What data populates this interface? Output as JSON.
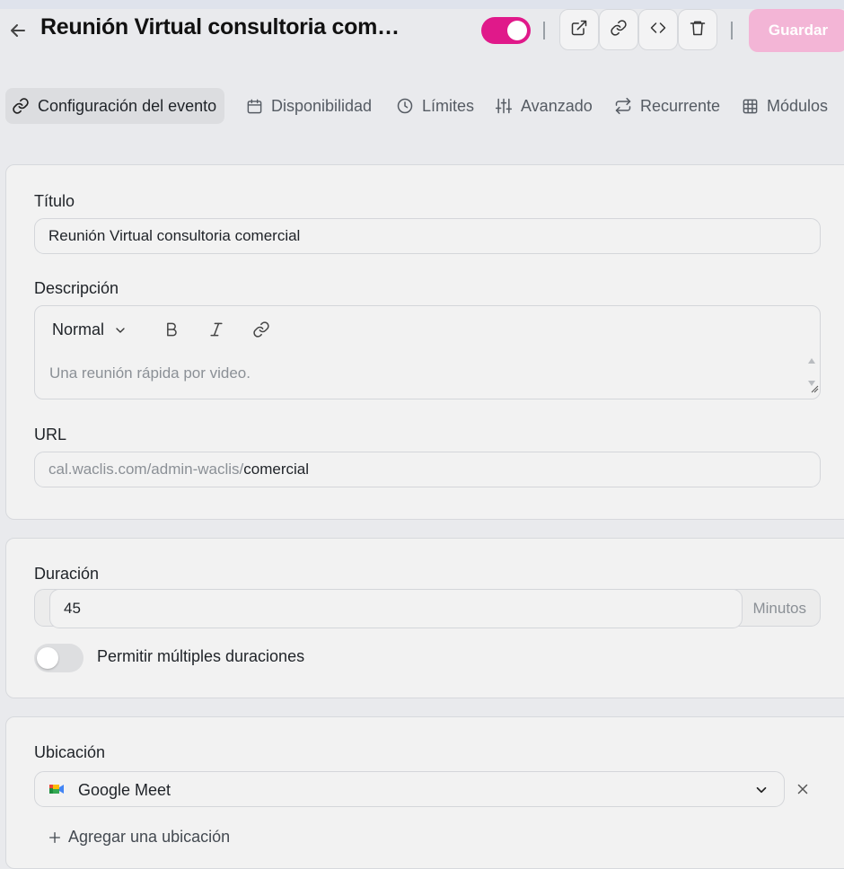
{
  "header": {
    "title": "Reunión Virtual consultoria com…",
    "enabled": true,
    "save_label": "Guardar",
    "actions": [
      "external-link-icon",
      "link-icon",
      "code-icon",
      "trash-icon"
    ]
  },
  "tabs": [
    {
      "label": "Configuración del evento",
      "icon": "link-icon",
      "active": true
    },
    {
      "label": "Disponibilidad",
      "icon": "calendar-icon",
      "active": false
    },
    {
      "label": "Límites",
      "icon": "clock-icon",
      "active": false
    },
    {
      "label": "Avanzado",
      "icon": "sliders-icon",
      "active": false
    },
    {
      "label": "Recurrente",
      "icon": "repeat-icon",
      "active": false
    },
    {
      "label": "Módulos",
      "icon": "grid-icon",
      "active": false
    }
  ],
  "form": {
    "title_label": "Título",
    "title_value": "Reunión Virtual consultoria comercial",
    "description_label": "Descripción",
    "editor_style": "Normal",
    "description_placeholder": "Una reunión rápida por video.",
    "url_label": "URL",
    "url_prefix": "cal.waclis.com/admin-waclis/",
    "url_slug": "comercial"
  },
  "duration": {
    "label": "Duración",
    "value": "45",
    "unit": "Minutos",
    "multiple_label": "Permitir múltiples duraciones",
    "multiple_enabled": false
  },
  "location": {
    "label": "Ubicación",
    "selected": "Google Meet",
    "add_label": "Agregar una ubicación"
  },
  "colors": {
    "accent": "#e0198a",
    "save_disabled": "#f3b5d6",
    "page_bg": "#e9eaed",
    "card_bg": "#f2f2f2"
  }
}
